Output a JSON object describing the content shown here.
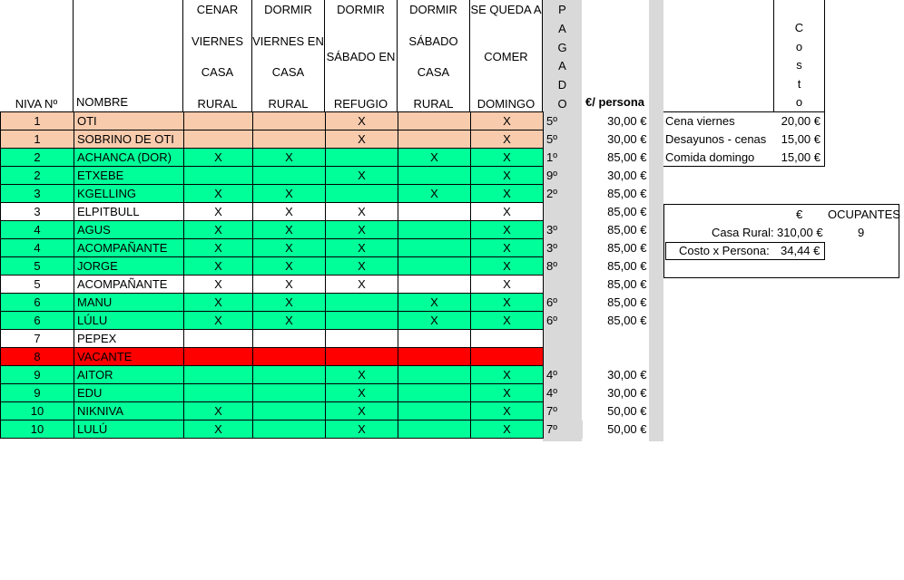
{
  "headers": {
    "niva": "NIVA Nº",
    "nombre": "NOMBRE",
    "cenar": [
      "CENAR",
      "VIERNES",
      "CASA",
      "RURAL"
    ],
    "dormir_viernes": [
      "DORMIR",
      "VIERNES EN",
      "CASA",
      "RURAL"
    ],
    "dormir_sabado_refugio": [
      "DORMIR",
      "SÁBADO EN",
      "REFUGIO"
    ],
    "dormir_sabado_casa": [
      "DORMIR",
      "SÁBADO",
      "CASA",
      "RURAL"
    ],
    "se_queda": [
      "SE QUEDA A",
      "COMER",
      "DOMINGO"
    ],
    "pagado": [
      "P",
      "A",
      "G",
      "A",
      "D",
      "O"
    ],
    "precio": "€/ persona",
    "costo": [
      "C",
      "o",
      "s",
      "t",
      "o"
    ]
  },
  "rows": [
    {
      "niva": "1",
      "nombre": "OTI",
      "cenar": "",
      "dv": "",
      "ds_ref": "X",
      "ds_casa": "",
      "domingo": "X",
      "pagado": "5º",
      "precio": "30,00 €",
      "color": "orange"
    },
    {
      "niva": "1",
      "nombre": "SOBRINO DE OTI",
      "cenar": "",
      "dv": "",
      "ds_ref": "X",
      "ds_casa": "",
      "domingo": "X",
      "pagado": "5º",
      "precio": "30,00 €",
      "color": "orange"
    },
    {
      "niva": "2",
      "nombre": "ACHANCA (DOR)",
      "cenar": "X",
      "dv": "X",
      "ds_ref": "",
      "ds_casa": "X",
      "domingo": "X",
      "pagado": "1º",
      "precio": "85,00 €",
      "color": "green"
    },
    {
      "niva": "2",
      "nombre": "ETXEBE",
      "cenar": "",
      "dv": "",
      "ds_ref": "X",
      "ds_casa": "",
      "domingo": "X",
      "pagado": "9º",
      "precio": "30,00 €",
      "color": "green"
    },
    {
      "niva": "3",
      "nombre": "KGELLING",
      "cenar": "X",
      "dv": "X",
      "ds_ref": "",
      "ds_casa": "X",
      "domingo": "X",
      "pagado": "2º",
      "precio": "85,00 €",
      "color": "green"
    },
    {
      "niva": "3",
      "nombre": "ELPITBULL",
      "cenar": "X",
      "dv": "X",
      "ds_ref": "X",
      "ds_casa": "",
      "domingo": "X",
      "pagado": "",
      "precio": "85,00 €",
      "color": "white"
    },
    {
      "niva": "4",
      "nombre": "AGUS",
      "cenar": "X",
      "dv": "X",
      "ds_ref": "X",
      "ds_casa": "",
      "domingo": "X",
      "pagado": "3º",
      "precio": "85,00 €",
      "color": "green"
    },
    {
      "niva": "4",
      "nombre": "ACOMPAÑANTE",
      "cenar": "X",
      "dv": "X",
      "ds_ref": "X",
      "ds_casa": "",
      "domingo": "X",
      "pagado": "3º",
      "precio": "85,00 €",
      "color": "green"
    },
    {
      "niva": "5",
      "nombre": "JORGE",
      "cenar": "X",
      "dv": "X",
      "ds_ref": "X",
      "ds_casa": "",
      "domingo": "X",
      "pagado": "8º",
      "precio": "85,00 €",
      "color": "green"
    },
    {
      "niva": "5",
      "nombre": "ACOMPAÑANTE",
      "cenar": "X",
      "dv": "X",
      "ds_ref": "X",
      "ds_casa": "",
      "domingo": "X",
      "pagado": "",
      "precio": "85,00 €",
      "color": "white"
    },
    {
      "niva": "6",
      "nombre": "MANU",
      "cenar": "X",
      "dv": "X",
      "ds_ref": "",
      "ds_casa": "X",
      "domingo": "X",
      "pagado": "6º",
      "precio": "85,00 €",
      "color": "green"
    },
    {
      "niva": "6",
      "nombre": "LÚLU",
      "cenar": "X",
      "dv": "X",
      "ds_ref": "",
      "ds_casa": "X",
      "domingo": "X",
      "pagado": "6º",
      "precio": "85,00 €",
      "color": "green"
    },
    {
      "niva": "7",
      "nombre": "PEPEX",
      "cenar": "",
      "dv": "",
      "ds_ref": "",
      "ds_casa": "",
      "domingo": "",
      "pagado": "",
      "precio": "",
      "color": "white"
    },
    {
      "niva": "8",
      "nombre": "VACANTE",
      "cenar": "",
      "dv": "",
      "ds_ref": "",
      "ds_casa": "",
      "domingo": "",
      "pagado": "",
      "precio": "",
      "color": "red"
    },
    {
      "niva": "9",
      "nombre": "AITOR",
      "cenar": "",
      "dv": "",
      "ds_ref": "X",
      "ds_casa": "",
      "domingo": "X",
      "pagado": "4º",
      "precio": "30,00 €",
      "color": "green"
    },
    {
      "niva": "9",
      "nombre": "EDU",
      "cenar": "",
      "dv": "",
      "ds_ref": "X",
      "ds_casa": "",
      "domingo": "X",
      "pagado": "4º",
      "precio": "30,00 €",
      "color": "green"
    },
    {
      "niva": "10",
      "nombre": "NIKNIVA",
      "cenar": "X",
      "dv": "",
      "ds_ref": "X",
      "ds_casa": "",
      "domingo": "X",
      "pagado": "7º",
      "precio": "50,00 €",
      "color": "green"
    },
    {
      "niva": "10",
      "nombre": "LULÚ",
      "cenar": "X",
      "dv": "",
      "ds_ref": "X",
      "ds_casa": "",
      "domingo": "X",
      "pagado": "7º",
      "precio": "50,00 €",
      "color": "green"
    }
  ],
  "costs": [
    {
      "label": "Cena viernes",
      "value": "20,00 €"
    },
    {
      "label": "Desayunos - cenas",
      "value": "15,00 €"
    },
    {
      "label": "Comida domingo",
      "value": "15,00 €"
    }
  ],
  "summary": {
    "euro_header": "€",
    "ocupantes_header": "OCUPANTES",
    "casa_rural_label": "Casa Rural:",
    "casa_rural_value": "310,00 €",
    "ocupantes_value": "9",
    "costo_persona_label": "Costo x Persona:",
    "costo_persona_value": "34,44 €"
  },
  "colors": {
    "orange": "#f8cbad",
    "green": "#00ff99",
    "red": "#ff0000",
    "gray": "#d9d9d9"
  }
}
